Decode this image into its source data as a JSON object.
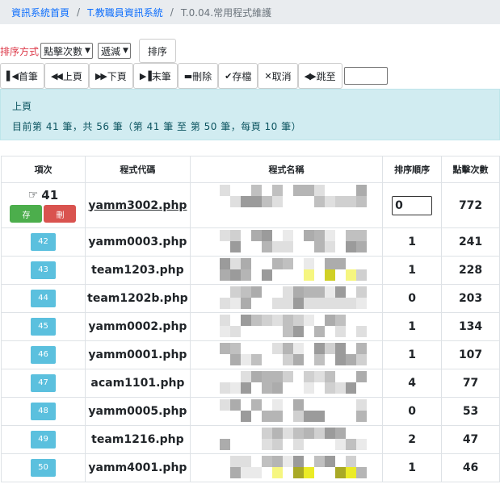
{
  "breadcrumb": {
    "items": [
      "資訊系統首頁",
      "T.教職員資訊系統"
    ],
    "current": "T.0.04.常用程式維護"
  },
  "sort": {
    "label": "排序方式",
    "field": "點擊次數",
    "direction": "遞減",
    "button": "排序"
  },
  "toolbar": {
    "first": "首筆",
    "prev": "上頁",
    "next": "下頁",
    "last": "末筆",
    "delete": "刪除",
    "save": "存檔",
    "cancel": "取消",
    "jump": "跳至"
  },
  "info": {
    "title": "上頁",
    "summary": "目前第 41 筆，共 56 筆（第 41 筆 至 第 50 筆，每頁 10 筆）"
  },
  "table": {
    "headers": [
      "項次",
      "程式代碼",
      "程式名稱",
      "排序順序",
      "點擊次數"
    ],
    "current": {
      "index": "41",
      "save_label": "存",
      "delete_label": "刪",
      "code": "yamm3002.php",
      "order": "0",
      "clicks": "772"
    },
    "rows": [
      {
        "index": "42",
        "code": "yamm0003.php",
        "order": "1",
        "clicks": "241"
      },
      {
        "index": "43",
        "code": "team1203.php",
        "order": "1",
        "clicks": "228"
      },
      {
        "index": "44",
        "code": "team1202b.php",
        "order": "0",
        "clicks": "203"
      },
      {
        "index": "45",
        "code": "yamm0002.php",
        "order": "1",
        "clicks": "134"
      },
      {
        "index": "46",
        "code": "yamm0001.php",
        "order": "1",
        "clicks": "107"
      },
      {
        "index": "47",
        "code": "acam1101.php",
        "order": "4",
        "clicks": "77"
      },
      {
        "index": "48",
        "code": "yamm0005.php",
        "order": "0",
        "clicks": "53"
      },
      {
        "index": "49",
        "code": "team1216.php",
        "order": "2",
        "clicks": "47"
      },
      {
        "index": "50",
        "code": "yamm4001.php",
        "order": "1",
        "clicks": "46"
      }
    ]
  },
  "icons": {
    "first": "step-backward-icon",
    "prev": "backward-icon",
    "next": "forward-icon",
    "last": "step-forward-icon",
    "delete": "minus-icon",
    "save": "check-icon",
    "cancel": "times-icon",
    "jump": "arrows-h-icon",
    "pointer": "hand-right-icon"
  },
  "colors": {
    "info_bg": "#d1ecf1",
    "badge": "#5bc0de",
    "save_btn": "#4cae4c",
    "delete_btn": "#d9534f",
    "sort_label": "#dc3545"
  }
}
